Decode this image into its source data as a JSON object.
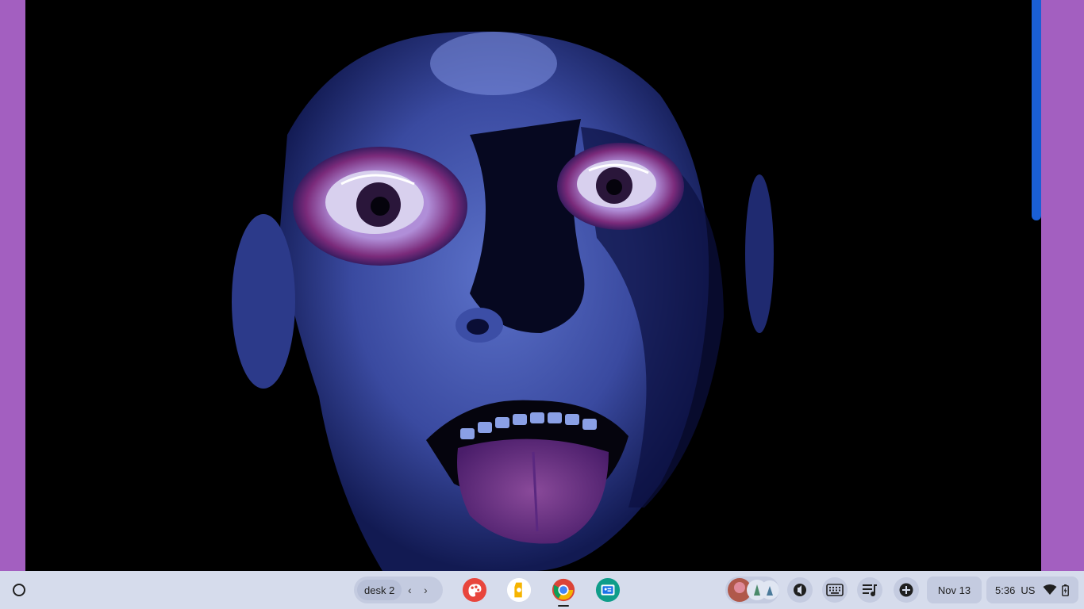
{
  "shelf": {
    "desk_name": "desk 2",
    "prev_desk_glyph": "‹",
    "next_desk_glyph": "›",
    "apps": [
      {
        "name": "paint-app",
        "color": "#e8453c"
      },
      {
        "name": "keep-app",
        "color": "#f6b400"
      },
      {
        "name": "chrome-app",
        "color": "#ffffff"
      },
      {
        "name": "classroom-app",
        "color": "#0f9d8a"
      }
    ]
  },
  "tray": {
    "date": "Nov 13",
    "time": "5:36",
    "input_method": "US"
  },
  "colors": {
    "wallpaper": "#a35fc0",
    "shelf": "#d6dcec",
    "scrollbar": "#1a5fd6"
  }
}
